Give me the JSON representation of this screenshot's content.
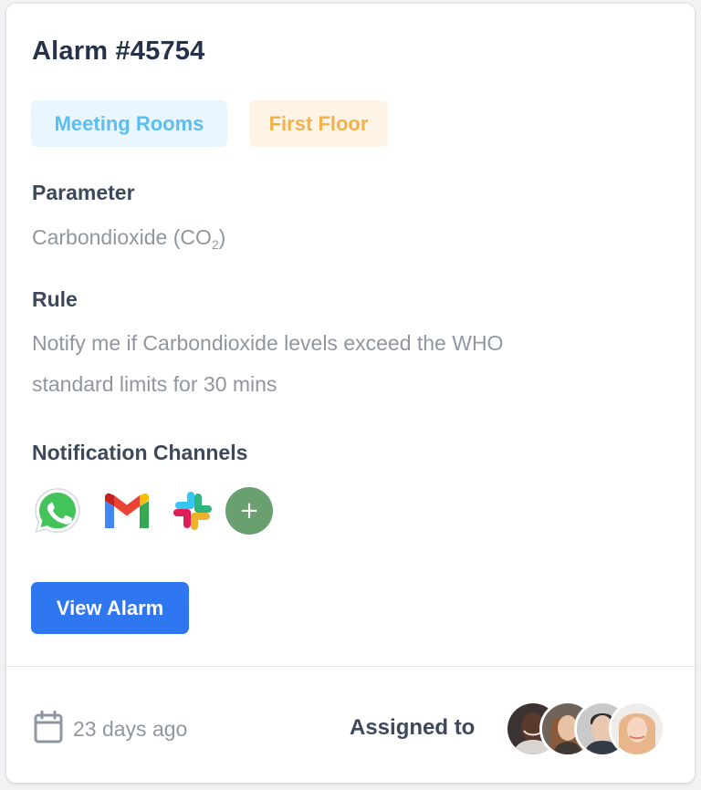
{
  "alarm": {
    "title": "Alarm #45754",
    "tags": [
      {
        "label": "Meeting Rooms",
        "text_color": "#5bbdf0",
        "bg_color": "#eaf6fd"
      },
      {
        "label": "First Floor",
        "text_color": "#f3b14b",
        "bg_color": "#fdf4e6"
      }
    ],
    "parameter": {
      "label": "Parameter",
      "value_text": "Carbondioxide (CO",
      "value_subscript": "2",
      "value_close": ")"
    },
    "rule": {
      "label": "Rule",
      "line1": "Notify me if Carbondioxide levels exceed the WHO",
      "line2": "standard limits for 30 mins"
    },
    "notification_channels": {
      "label": "Notification Channels",
      "icons": [
        "whatsapp-icon",
        "gmail-icon",
        "slack-icon",
        "add-icon"
      ],
      "add_symbol": "+"
    },
    "view_button": {
      "label": "View Alarm",
      "color": "#2e77f0"
    }
  },
  "footer": {
    "time_icon": "calendar-icon",
    "time_ago": "23 days ago",
    "assigned_label": "Assigned to",
    "assignees": [
      "avatar",
      "avatar",
      "avatar",
      "avatar"
    ]
  }
}
